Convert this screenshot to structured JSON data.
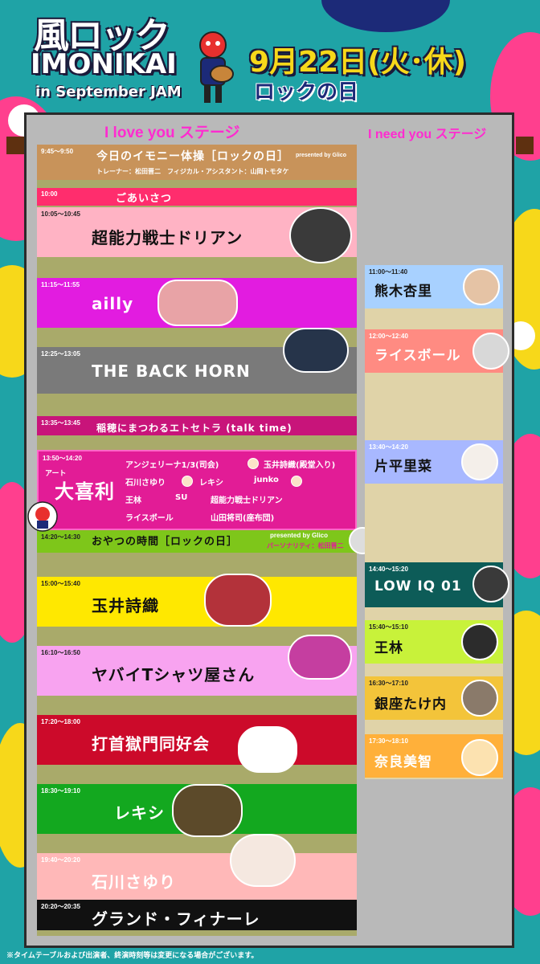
{
  "header": {
    "logo_jp": "風ロック",
    "logo_en": "IMONIKAI",
    "logo_sub": "in September JAM",
    "date": "9月22日(火･休)",
    "event_day": "ロックの日"
  },
  "stages": {
    "left_title": "I love you ステージ",
    "right_title": "I need you ステージ"
  },
  "left_schedule": [
    {
      "time": "9:45～9:50",
      "title": "今日のイモニー体操［ロックの日］",
      "presented": "presented by Glico",
      "sub": "トレーナー：松田晋二　フィジカル・アシスタント：山岡トモタケ"
    },
    {
      "time": "10:00",
      "title": "ごあいさつ"
    },
    {
      "time": "10:05～10:45",
      "title": "超能力戦士ドリアン"
    },
    {
      "time": "11:15～11:55",
      "title": "ailly"
    },
    {
      "time": "12:25～13:05",
      "title": "THE BACK HORN"
    },
    {
      "time": "13:35～13:45",
      "title": "稲穂にまつわるエトセトラ (talk time)"
    },
    {
      "time": "13:50～14:20",
      "title": "大喜利",
      "ruby": "アート"
    },
    {
      "time": "14:20～14:30",
      "title": "おやつの時間［ロックの日］",
      "presented": "presented by Glico",
      "sub": "パーソナリティ：松田晋二"
    },
    {
      "time": "15:00～15:40",
      "title": "玉井詩織"
    },
    {
      "time": "16:10～16:50",
      "title": "ヤバイTシャツ屋さん"
    },
    {
      "time": "17:20～18:00",
      "title": "打首獄門同好会"
    },
    {
      "time": "18:30～19:10",
      "title": "レキシ"
    },
    {
      "time": "19:40～20:20",
      "title": "石川さゆり"
    },
    {
      "time": "20:20～20:35",
      "title": "グランド・フィナーレ"
    }
  ],
  "ogiri_members": [
    "アンジェリーナ1/3(司会)",
    "玉井詩織(殿堂入り)",
    "石川さゆり",
    "レキシ",
    "junko",
    "王林",
    "SU",
    "超能力戦士ドリアン",
    "ライスボール",
    "山田将司(座布団)"
  ],
  "right_schedule": [
    {
      "time": "11:00～11:40",
      "title": "熊木杏里"
    },
    {
      "time": "12:00～12:40",
      "title": "ライスボール"
    },
    {
      "time": "13:40～14:20",
      "title": "片平里菜"
    },
    {
      "time": "14:40～15:20",
      "title": "LOW IQ 01"
    },
    {
      "time": "15:40～15:10",
      "title": "王林"
    },
    {
      "time": "16:30～17:10",
      "title": "銀座たけ内"
    },
    {
      "time": "17:30～18:10",
      "title": "奈良美智"
    }
  ],
  "footnote": "※タイムテーブルおよび出演者、終演時刻等は変更になる場合がございます。",
  "colors": {
    "background": "#1fa3a6",
    "panel": "#b9b9b9",
    "gap_left": "#a9aa6a",
    "gap_right": "#e0d3a8",
    "stage_title": "#ff2bd0",
    "date": "#f7d81a"
  }
}
